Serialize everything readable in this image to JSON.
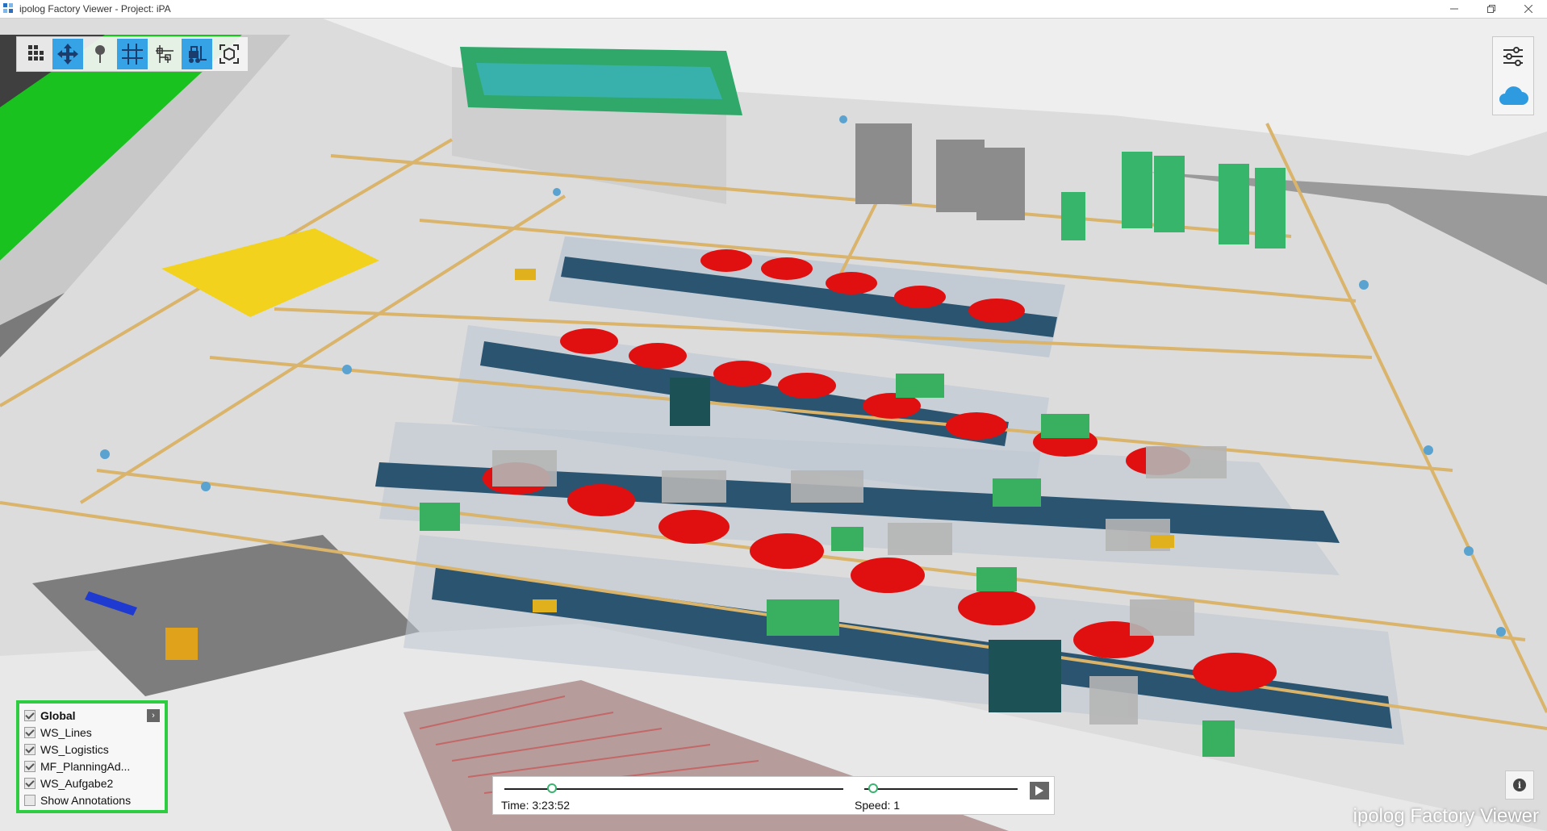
{
  "window": {
    "title": "ipolog Factory Viewer - Project: iPA",
    "controls": [
      "minimize-icon",
      "restore-icon",
      "close-icon"
    ]
  },
  "toolbar": {
    "tools": [
      {
        "name": "grid-menu-icon",
        "active": false
      },
      {
        "name": "move-icon",
        "active": true
      },
      {
        "name": "pin-icon",
        "active": false
      },
      {
        "name": "grid-overlay-icon",
        "active": true
      },
      {
        "name": "path-network-icon",
        "active": false
      },
      {
        "name": "forklift-icon",
        "active": true
      },
      {
        "name": "focus-camera-icon",
        "active": false
      }
    ]
  },
  "right_panel": {
    "items": [
      "settings-sliders-icon",
      "cloud-icon"
    ]
  },
  "layers": {
    "items": [
      {
        "label": "Global",
        "checked": true,
        "bold": true
      },
      {
        "label": "WS_Lines",
        "checked": true
      },
      {
        "label": "WS_Logistics",
        "checked": true
      },
      {
        "label": "MF_PlanningAd...",
        "checked": true
      },
      {
        "label": "WS_Aufgabe2",
        "checked": true
      },
      {
        "label": "Show Annotations",
        "checked": false
      }
    ]
  },
  "playback": {
    "time_label": "Time: 3:23:52",
    "speed_label": "Speed: 1",
    "time_progress": 0.14,
    "speed_progress": 0.06
  },
  "watermark": "ipolog Factory Viewer",
  "colors": {
    "accent": "#35a3e6",
    "layer_border": "#2ecc40",
    "car": "#e01010",
    "floor": "#dedede",
    "path": "#d9b46a",
    "green_area": "#19c21f",
    "sky": "#3a5ea8"
  }
}
